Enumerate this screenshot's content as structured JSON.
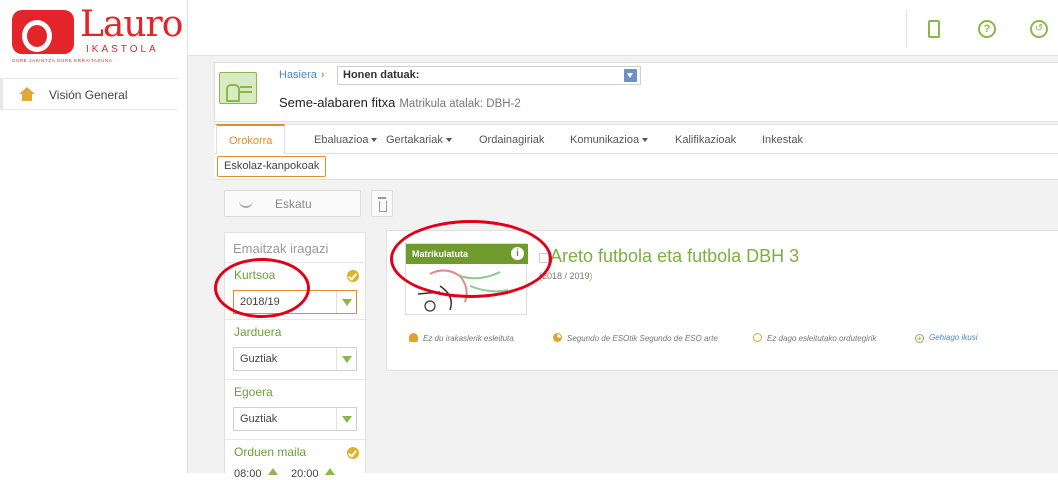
{
  "logo": {
    "word": "Lauro",
    "sub": "IKASTOLA",
    "tagline": "GURE JAKINTZA GURE ERRAITASUNA"
  },
  "sidebar": {
    "items": [
      {
        "label": "Visión General",
        "icon": "home-icon"
      }
    ]
  },
  "topbar": {
    "icons": [
      "tablet-icon",
      "help-icon",
      "history-icon"
    ],
    "help_glyph": "?",
    "history_glyph": "↺"
  },
  "breadcrumb": {
    "home": "Hasiera",
    "sep": "›",
    "current_prefix": "Honen datuak:"
  },
  "header": {
    "title": "Seme-alabaren fitxa",
    "subtitle": "Matrikula atalak: DBH-2"
  },
  "tabs": [
    {
      "label": "Orokorra",
      "active": true,
      "dropdown": false
    },
    {
      "label": "Ebaluazioa",
      "active": false,
      "dropdown": true
    },
    {
      "label": "Gertakariak",
      "active": false,
      "dropdown": true
    },
    {
      "label": "Ordainagiriak",
      "active": false,
      "dropdown": false
    },
    {
      "label": "Komunikazioa",
      "active": false,
      "dropdown": true
    },
    {
      "label": "Kalifikazioak",
      "active": false,
      "dropdown": false
    },
    {
      "label": "Inkestak",
      "active": false,
      "dropdown": false
    }
  ],
  "subtabs": [
    {
      "label": "Eskolaz-kanpokoak"
    }
  ],
  "actions": {
    "request_label": "Eskatu"
  },
  "filters": {
    "title": "Emaitzak iragazi",
    "course": {
      "label": "Kurtsoa",
      "value": "2018/19",
      "checked": true
    },
    "activity": {
      "label": "Jarduera",
      "value": "Guztiak"
    },
    "state": {
      "label": "Egoera",
      "value": "Guztiak"
    },
    "schedule": {
      "label": "Orduen maila",
      "from": "08:00",
      "to": "20:00",
      "checked": true
    }
  },
  "activity": {
    "badge": "Matrikulatuta",
    "badge_info": "i",
    "title": "Areto futbola eta futbola DBH 3",
    "year_open": "(",
    "year": "2018 / 2019",
    "year_close": ")",
    "info": [
      {
        "icon": "person-icon",
        "text": "Ez du irakaslerik esleituta"
      },
      {
        "icon": "pie-icon",
        "text": "Segundo de ESOtik Segundo de ESO arte"
      },
      {
        "icon": "clock-icon",
        "text": "Ez dago esleitutako ordutegirik"
      },
      {
        "icon": "plus-icon",
        "text": "Gehiago ikusi"
      }
    ]
  },
  "colors": {
    "accent": "#e38d2c",
    "brand_green": "#8cb74a",
    "brand_red": "#e3242b",
    "annotation": "#e0001a"
  }
}
